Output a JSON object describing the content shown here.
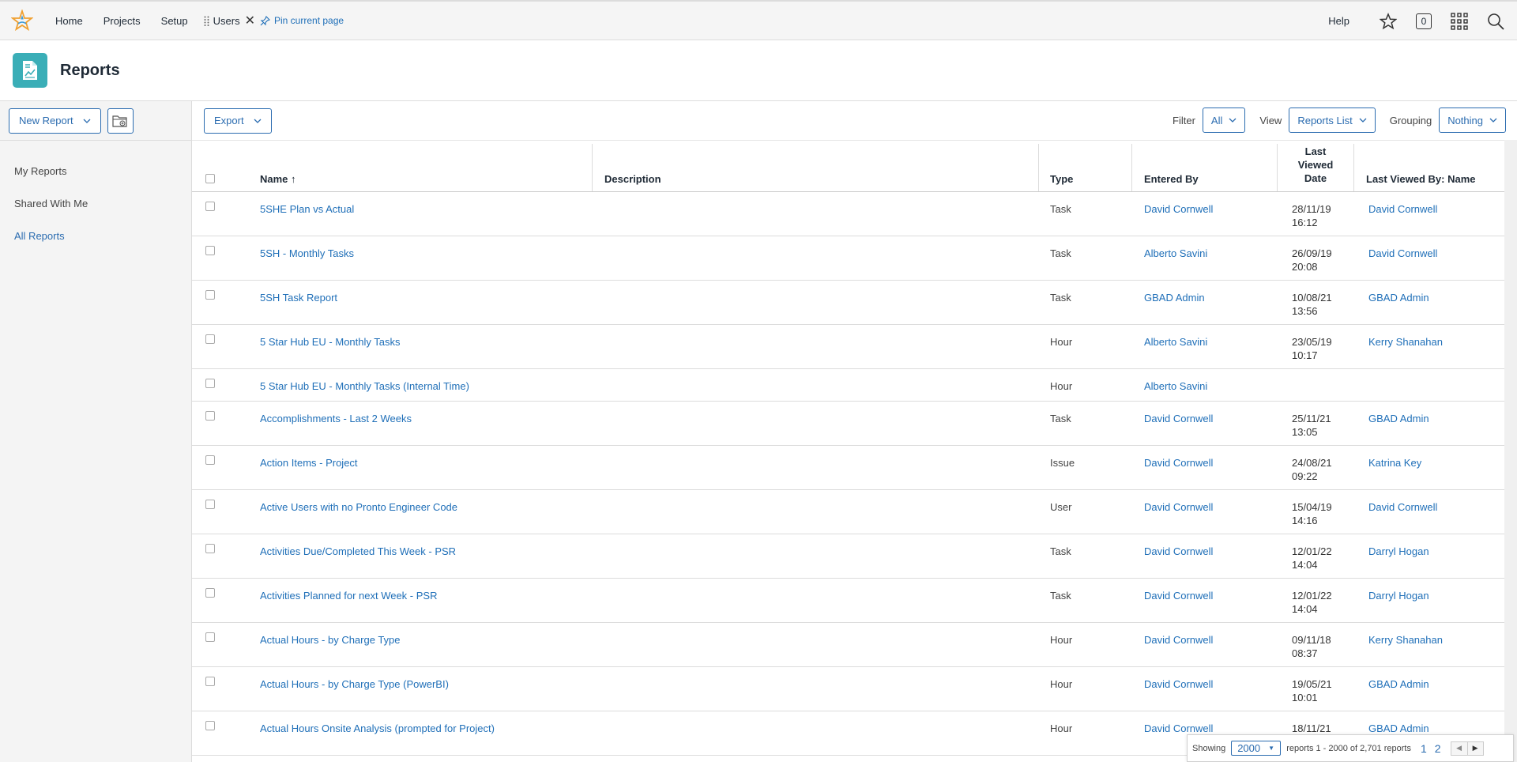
{
  "topnav": {
    "items": [
      "Home",
      "Projects",
      "Setup"
    ],
    "pinned_tab": "Users",
    "pin_label": "Pin current page",
    "help": "Help",
    "notifications_count": "0"
  },
  "header": {
    "title": "Reports"
  },
  "sidebar": {
    "new_report": "New Report",
    "links": [
      "My Reports",
      "Shared With Me",
      "All Reports"
    ],
    "active": "All Reports"
  },
  "toolbar": {
    "export": "Export",
    "filter_label": "Filter",
    "filter_value": "All",
    "view_label": "View",
    "view_value": "Reports List",
    "grouping_label": "Grouping",
    "grouping_value": "Nothing"
  },
  "table": {
    "columns": {
      "name": "Name",
      "description": "Description",
      "type": "Type",
      "entered_by": "Entered By",
      "last_viewed_date": [
        "Last",
        "Viewed",
        "Date"
      ],
      "last_viewed_by": "Last Viewed By: Name"
    },
    "sort_indicator": "↑",
    "rows": [
      {
        "name": "5SHE Plan vs Actual",
        "type": "Task",
        "entered_by": "David Cornwell",
        "date": "28/11/19",
        "time": "16:12",
        "viewed_by": "David Cornwell"
      },
      {
        "name": "5SH - Monthly Tasks",
        "type": "Task",
        "entered_by": "Alberto Savini",
        "date": "26/09/19",
        "time": "20:08",
        "viewed_by": "David Cornwell"
      },
      {
        "name": "5SH Task Report",
        "type": "Task",
        "entered_by": "GBAD Admin",
        "date": "10/08/21",
        "time": "13:56",
        "viewed_by": "GBAD Admin"
      },
      {
        "name": "5 Star Hub EU - Monthly Tasks",
        "type": "Hour",
        "entered_by": "Alberto Savini",
        "date": "23/05/19",
        "time": "10:17",
        "viewed_by": "Kerry Shanahan"
      },
      {
        "name": "5 Star Hub EU - Monthly Tasks (Internal Time)",
        "type": "Hour",
        "entered_by": "Alberto Savini",
        "date": "",
        "time": "",
        "viewed_by": ""
      },
      {
        "name": "Accomplishments - Last 2 Weeks",
        "type": "Task",
        "entered_by": "David Cornwell",
        "date": "25/11/21",
        "time": "13:05",
        "viewed_by": "GBAD Admin"
      },
      {
        "name": "Action Items - Project",
        "type": "Issue",
        "entered_by": "David Cornwell",
        "date": "24/08/21",
        "time": "09:22",
        "viewed_by": "Katrina Key"
      },
      {
        "name": "Active Users with no Pronto Engineer Code",
        "type": "User",
        "entered_by": "David Cornwell",
        "date": "15/04/19",
        "time": "14:16",
        "viewed_by": "David Cornwell"
      },
      {
        "name": "Activities Due/Completed This Week - PSR",
        "type": "Task",
        "entered_by": "David Cornwell",
        "date": "12/01/22",
        "time": "14:04",
        "viewed_by": "Darryl Hogan"
      },
      {
        "name": "Activities Planned for next Week - PSR",
        "type": "Task",
        "entered_by": "David Cornwell",
        "date": "12/01/22",
        "time": "14:04",
        "viewed_by": "Darryl Hogan"
      },
      {
        "name": "Actual Hours - by Charge Type",
        "type": "Hour",
        "entered_by": "David Cornwell",
        "date": "09/11/18",
        "time": "08:37",
        "viewed_by": "Kerry Shanahan"
      },
      {
        "name": "Actual Hours - by Charge Type (PowerBI)",
        "type": "Hour",
        "entered_by": "David Cornwell",
        "date": "19/05/21",
        "time": "10:01",
        "viewed_by": "GBAD Admin"
      },
      {
        "name": "Actual Hours Onsite Analysis (prompted for Project)",
        "type": "Hour",
        "entered_by": "David Cornwell",
        "date": "18/11/21",
        "time": "",
        "viewed_by": "GBAD Admin"
      }
    ]
  },
  "pager": {
    "showing": "Showing",
    "page_size": "2000",
    "range": "reports 1 - 2000 of 2,701 reports",
    "pages": [
      "1",
      "2"
    ]
  },
  "colors": {
    "accent": "#2b6cb0",
    "link": "#1f6fb8",
    "brand_tile": "#3aaeb7"
  }
}
